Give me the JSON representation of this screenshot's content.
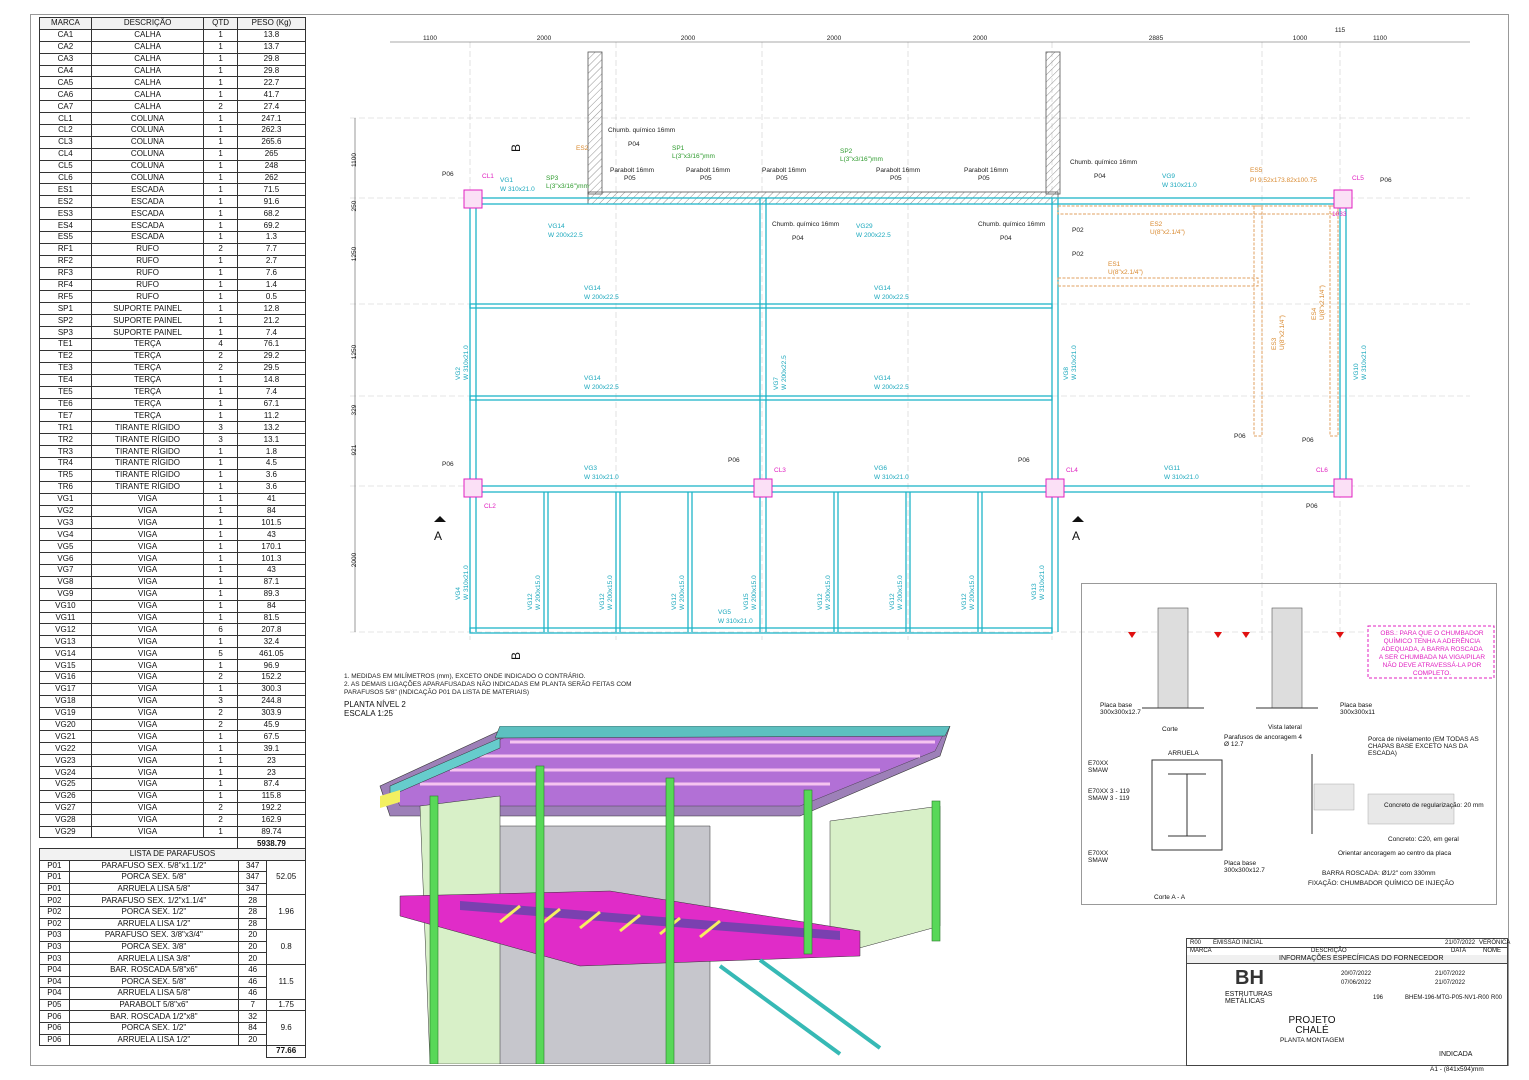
{
  "materials": {
    "headers": [
      "MARCA",
      "DESCRIÇÃO",
      "QTD",
      "PESO (Kg)"
    ],
    "rows": [
      [
        "CA1",
        "CALHA",
        "1",
        "13.8"
      ],
      [
        "CA2",
        "CALHA",
        "1",
        "13.7"
      ],
      [
        "CA3",
        "CALHA",
        "1",
        "29.8"
      ],
      [
        "CA4",
        "CALHA",
        "1",
        "29.8"
      ],
      [
        "CA5",
        "CALHA",
        "1",
        "22.7"
      ],
      [
        "CA6",
        "CALHA",
        "1",
        "41.7"
      ],
      [
        "CA7",
        "CALHA",
        "2",
        "27.4"
      ],
      [
        "CL1",
        "COLUNA",
        "1",
        "247.1"
      ],
      [
        "CL2",
        "COLUNA",
        "1",
        "262.3"
      ],
      [
        "CL3",
        "COLUNA",
        "1",
        "265.6"
      ],
      [
        "CL4",
        "COLUNA",
        "1",
        "265"
      ],
      [
        "CL5",
        "COLUNA",
        "1",
        "248"
      ],
      [
        "CL6",
        "COLUNA",
        "1",
        "262"
      ],
      [
        "ES1",
        "ESCADA",
        "1",
        "71.5"
      ],
      [
        "ES2",
        "ESCADA",
        "1",
        "91.6"
      ],
      [
        "ES3",
        "ESCADA",
        "1",
        "68.2"
      ],
      [
        "ES4",
        "ESCADA",
        "1",
        "69.2"
      ],
      [
        "ES5",
        "ESCADA",
        "1",
        "1.3"
      ],
      [
        "RF1",
        "RUFO",
        "2",
        "7.7"
      ],
      [
        "RF2",
        "RUFO",
        "1",
        "2.7"
      ],
      [
        "RF3",
        "RUFO",
        "1",
        "7.6"
      ],
      [
        "RF4",
        "RUFO",
        "1",
        "1.4"
      ],
      [
        "RF5",
        "RUFO",
        "1",
        "0.5"
      ],
      [
        "SP1",
        "SUPORTE PAINEL",
        "1",
        "12.8"
      ],
      [
        "SP2",
        "SUPORTE PAINEL",
        "1",
        "21.2"
      ],
      [
        "SP3",
        "SUPORTE PAINEL",
        "1",
        "7.4"
      ],
      [
        "TE1",
        "TERÇA",
        "4",
        "76.1"
      ],
      [
        "TE2",
        "TERÇA",
        "2",
        "29.2"
      ],
      [
        "TE3",
        "TERÇA",
        "2",
        "29.5"
      ],
      [
        "TE4",
        "TERÇA",
        "1",
        "14.8"
      ],
      [
        "TE5",
        "TERÇA",
        "1",
        "7.4"
      ],
      [
        "TE6",
        "TERÇA",
        "1",
        "67.1"
      ],
      [
        "TE7",
        "TERÇA",
        "1",
        "11.2"
      ],
      [
        "TR1",
        "TIRANTE RÍGIDO",
        "3",
        "13.2"
      ],
      [
        "TR2",
        "TIRANTE RÍGIDO",
        "3",
        "13.1"
      ],
      [
        "TR3",
        "TIRANTE RÍGIDO",
        "1",
        "1.8"
      ],
      [
        "TR4",
        "TIRANTE RÍGIDO",
        "1",
        "4.5"
      ],
      [
        "TR5",
        "TIRANTE RÍGIDO",
        "1",
        "3.6"
      ],
      [
        "TR6",
        "TIRANTE RÍGIDO",
        "1",
        "3.6"
      ],
      [
        "VG1",
        "VIGA",
        "1",
        "41"
      ],
      [
        "VG2",
        "VIGA",
        "1",
        "84"
      ],
      [
        "VG3",
        "VIGA",
        "1",
        "101.5"
      ],
      [
        "VG4",
        "VIGA",
        "1",
        "43"
      ],
      [
        "VG5",
        "VIGA",
        "1",
        "170.1"
      ],
      [
        "VG6",
        "VIGA",
        "1",
        "101.3"
      ],
      [
        "VG7",
        "VIGA",
        "1",
        "43"
      ],
      [
        "VG8",
        "VIGA",
        "1",
        "87.1"
      ],
      [
        "VG9",
        "VIGA",
        "1",
        "89.3"
      ],
      [
        "VG10",
        "VIGA",
        "1",
        "84"
      ],
      [
        "VG11",
        "VIGA",
        "1",
        "81.5"
      ],
      [
        "VG12",
        "VIGA",
        "6",
        "207.8"
      ],
      [
        "VG13",
        "VIGA",
        "1",
        "32.4"
      ],
      [
        "VG14",
        "VIGA",
        "5",
        "461.05"
      ],
      [
        "VG15",
        "VIGA",
        "1",
        "96.9"
      ],
      [
        "VG16",
        "VIGA",
        "2",
        "152.2"
      ],
      [
        "VG17",
        "VIGA",
        "1",
        "300.3"
      ],
      [
        "VG18",
        "VIGA",
        "3",
        "244.8"
      ],
      [
        "VG19",
        "VIGA",
        "2",
        "303.9"
      ],
      [
        "VG20",
        "VIGA",
        "2",
        "45.9"
      ],
      [
        "VG21",
        "VIGA",
        "1",
        "67.5"
      ],
      [
        "VG22",
        "VIGA",
        "1",
        "39.1"
      ],
      [
        "VG23",
        "VIGA",
        "1",
        "23"
      ],
      [
        "VG24",
        "VIGA",
        "1",
        "23"
      ],
      [
        "VG25",
        "VIGA",
        "1",
        "87.4"
      ],
      [
        "VG26",
        "VIGA",
        "1",
        "115.8"
      ],
      [
        "VG27",
        "VIGA",
        "2",
        "192.2"
      ],
      [
        "VG28",
        "VIGA",
        "2",
        "162.9"
      ],
      [
        "VG29",
        "VIGA",
        "1",
        "89.74"
      ]
    ],
    "total": "5938.79"
  },
  "bolts": {
    "title": "LISTA DE PARAFUSOS",
    "groups": [
      {
        "items": [
          [
            "P01",
            "PARAFUSO SEX. 5/8\"x1.1/2\"",
            "347"
          ],
          [
            "P01",
            "PORCA SEX. 5/8\"",
            "347"
          ],
          [
            "P01",
            "ARRUELA LISA 5/8\"",
            "347"
          ]
        ],
        "weight": "52.05"
      },
      {
        "items": [
          [
            "P02",
            "PARAFUSO SEX. 1/2\"x1.1/4\"",
            "28"
          ],
          [
            "P02",
            "PORCA SEX. 1/2\"",
            "28"
          ],
          [
            "P02",
            "ARRUELA LISA 1/2\"",
            "28"
          ]
        ],
        "weight": "1.96"
      },
      {
        "items": [
          [
            "P03",
            "PARAFUSO SEX. 3/8\"x3/4\"",
            "20"
          ],
          [
            "P03",
            "PORCA SEX. 3/8\"",
            "20"
          ],
          [
            "P03",
            "ARRUELA LISA 3/8\"",
            "20"
          ]
        ],
        "weight": "0.8"
      },
      {
        "items": [
          [
            "P04",
            "BAR. ROSCADA 5/8\"x6\"",
            "46"
          ],
          [
            "P04",
            "PORCA SEX. 5/8\"",
            "46"
          ],
          [
            "P04",
            "ARRUELA LISA 5/8\"",
            "46"
          ]
        ],
        "weight": "11.5"
      },
      {
        "items": [
          [
            "P05",
            "PARABOLT 5/8\"x6\"",
            "7"
          ]
        ],
        "weight": "1.75"
      },
      {
        "items": [
          [
            "P06",
            "BAR. ROSCADA 1/2\"x8\"",
            "32"
          ],
          [
            "P06",
            "PORCA SEX. 1/2\"",
            "84"
          ],
          [
            "P06",
            "ARRUELA LISA 1/2\"",
            "20"
          ]
        ],
        "weight": "9.6"
      }
    ],
    "total": "77.66"
  },
  "plan": {
    "dims": [
      "1100",
      "2000",
      "2000",
      "2000",
      "2000",
      "2885",
      "1000",
      "1100",
      "115"
    ],
    "vdims": [
      "1100",
      "250",
      "1250",
      "1250",
      "329",
      "921",
      "2000"
    ],
    "beams": [
      "VG1",
      "VG14",
      "VG29",
      "VG9",
      "VG3",
      "VG6",
      "VG11",
      "VG5",
      "VG2",
      "VG4",
      "VG7",
      "VG8",
      "VG10",
      "VG12",
      "VG13",
      "VG15"
    ],
    "beam_h": [
      "W 310x21.0",
      "W 200x22.5",
      "W 200x15.0"
    ],
    "columns": [
      "CL1",
      "CL2",
      "CL3",
      "CL4",
      "CL5",
      "CL6"
    ],
    "stairs": [
      "ES1",
      "ES2",
      "ES3",
      "ES4",
      "ES5"
    ],
    "supports": [
      "SP1",
      "SP2",
      "SP3"
    ],
    "sp_profile": "L(3\"x3/16\")mm",
    "es_profiles": [
      "U(8\"x2.1/4\")",
      "PI 9.52x173.82x100.75"
    ],
    "anchors": [
      "Chumb. químico 16mm",
      "Parabolt 16mm"
    ],
    "marks": [
      "P02",
      "P04",
      "P05",
      "P06"
    ],
    "section_a": "A",
    "section_b": "B",
    "dim_1033": "1033",
    "notes": [
      "1.   MEDIDAS EM MILÍMETROS (mm), EXCETO ONDE INDICADO O CONTRÁRIO.",
      "2.   AS DEMAIS LIGAÇÕES APARAFUSADAS NÃO INDICADAS EM PLANTA SERÃO FEITAS COM",
      "      PARAFUSOS 5/8\" (INDICAÇÃO P01 DA LISTA DE MATERIAIS)"
    ],
    "title": "PLANTA NÍVEL 2",
    "scale": "ESCALA 1:25"
  },
  "detail": {
    "obs": [
      "OBS.: PARA QUE O CHUMBADOR",
      "QUÍMICO TENHA A ADERÊNCIA",
      "ADEQUADA, A BARRA ROSCADA",
      "A SER CHUMBADA NA VIGA/PILAR",
      "NÃO DEVE ATRAVESSÁ-LA POR",
      "COMPLETO."
    ],
    "corte": "Corte",
    "vista": "Vista lateral",
    "placa1": "Placa base 300x300x12.7",
    "placa2": "Placa base 300x300x11",
    "parafusos": "Parafusos de ancoragem 4 Ø 12.7",
    "arruela": "ARRUELA",
    "smaw1": "E70XX SMAW",
    "smaw_leg": "5",
    "smaw2": "E70XX 3 - 119 SMAW 3 - 119",
    "porca": "Porca de nivelamento (EM TODAS AS CHAPAS BASE EXCETO NAS DA ESCADA)",
    "concreto_reg": "Concreto de regularização: 20 mm",
    "concreto": "Concreto: C20, em geral",
    "orientar": "Orientar ancoragem ao centro da placa",
    "barra": "BARRA ROSCADA:   Ø1/2\" com 330mm",
    "fixacao": "FIXAÇÃO: CHUMBADOR QUÍMICO DE INJEÇÃO",
    "corte_aa": "Corte A - A",
    "dims": [
      "30",
      "240",
      "30",
      "300",
      "240",
      "300",
      "200"
    ]
  },
  "titleblock": {
    "rev": "R00",
    "emissao": "EMISSÃO INICIAL",
    "rev_date": "21/07/2022",
    "rev_name": "VERÔNICA",
    "marca": "MARCA",
    "descricao": "DESCRIÇÃO",
    "data": "DATA",
    "nome": "NOME",
    "info": "INFORMAÇÕES ESPECÍFICAS DO FORNECEDOR",
    "company": "BH",
    "company_sub": "ESTRUTURAS METÁLICAS",
    "date1": "20/07/2022",
    "date2": "07/06/2022",
    "date3": "21/07/2022",
    "date4": "21/07/2022",
    "cliente": "196",
    "doc": "BHEM-196-MTG-P05-NV1-R00",
    "rev_code": "R00",
    "proj1": "PROJETO",
    "proj2": "CHALÉ",
    "proj3": "PLANTA MONTAGEM",
    "escala": "INDICADA",
    "format": "A1 - (841x594)mm"
  }
}
